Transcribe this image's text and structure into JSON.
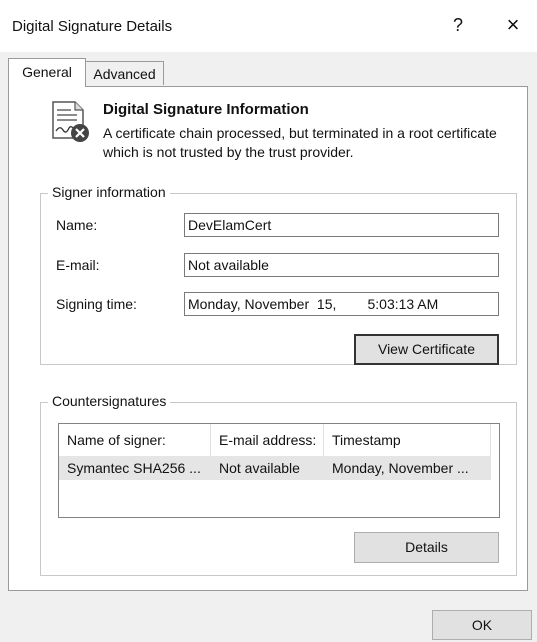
{
  "window": {
    "title": "Digital Signature Details",
    "help_label": "?",
    "close_label": "×"
  },
  "tabs": [
    {
      "label": "General"
    },
    {
      "label": "Advanced"
    }
  ],
  "info": {
    "title": "Digital Signature Information",
    "text": "A certificate chain processed, but terminated in a root certificate which is not trusted by the trust provider.",
    "icon": "certificate-error-icon"
  },
  "signer": {
    "group_label": "Signer information",
    "name_label": "Name:",
    "name_value": "DevElamCert",
    "email_label": "E-mail:",
    "email_value": "Not available",
    "time_label": "Signing time:",
    "time_value": "Monday, November  15,        5:03:13 AM",
    "view_button": "View Certificate"
  },
  "countersignatures": {
    "group_label": "Countersignatures",
    "columns": [
      "Name of signer:",
      "E-mail address:",
      "Timestamp"
    ],
    "rows": [
      [
        "Symantec SHA256 ...",
        "Not available",
        "Monday, November ..."
      ]
    ],
    "details_button": "Details"
  },
  "footer": {
    "ok_button": "OK"
  }
}
